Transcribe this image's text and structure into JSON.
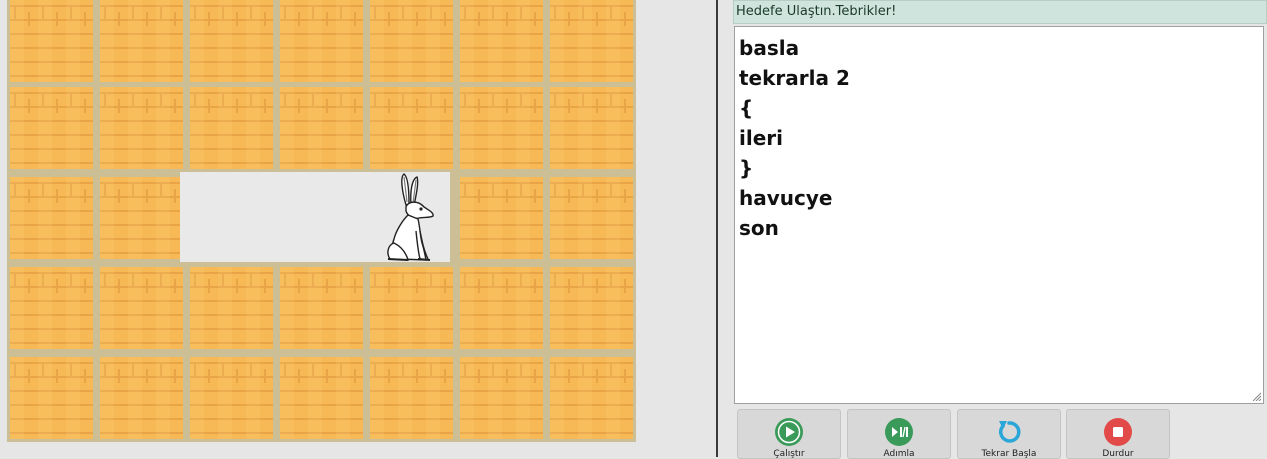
{
  "status": {
    "message": "Hedefe Ulaştın.Tebrikler!"
  },
  "code": {
    "lines": [
      "basla",
      "tekrarla 2",
      "{",
      "ileri",
      "}",
      "havucye",
      "son"
    ]
  },
  "toolbar": {
    "run_label": "Çalıştır",
    "step_label": "Adımla",
    "restart_label": "Tekrar Başla",
    "stop_label": "Durdur"
  },
  "colors": {
    "run": "#3a9a5a",
    "step": "#3a9a5a",
    "restart": "#2aa6d8",
    "stop": "#e24a4a",
    "brick": "#f7b955",
    "status_bg": "#cfe4dc"
  },
  "icons": {
    "run": "play-icon",
    "step": "play-pause-icon",
    "restart": "restart-icon",
    "stop": "stop-icon",
    "character": "rabbit-icon"
  }
}
